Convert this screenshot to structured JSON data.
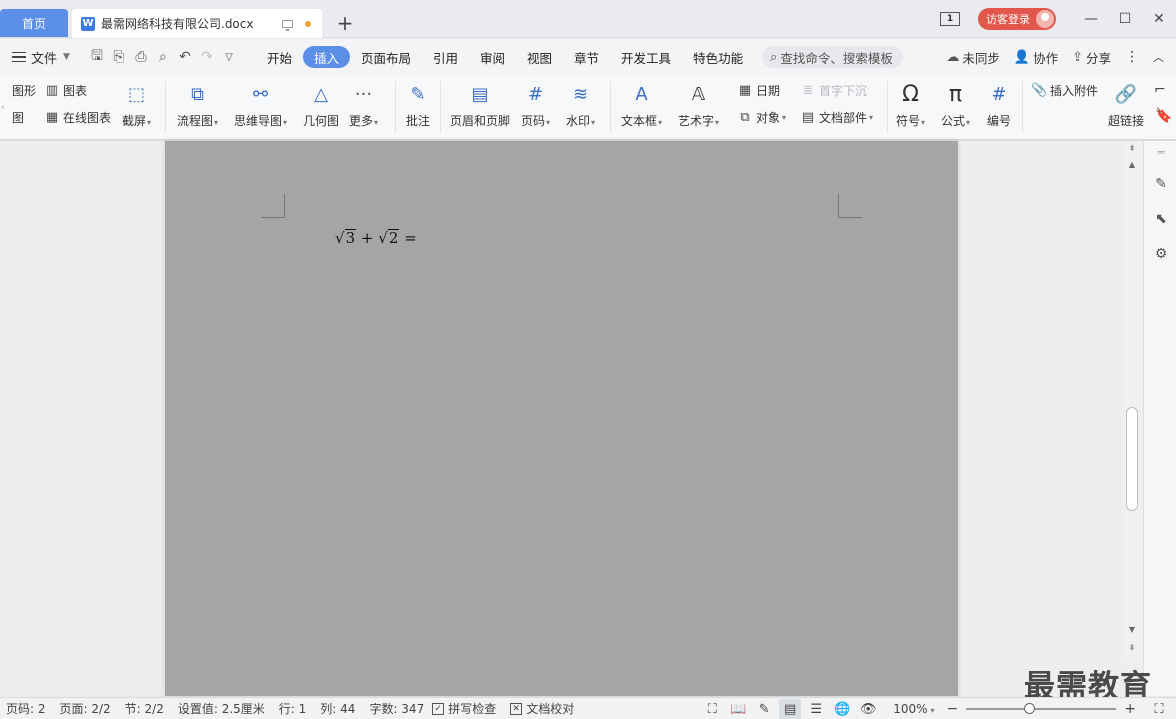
{
  "titlebar": {
    "home_tab": "首页",
    "doc_tab_title": "最需网络科技有限公司.docx",
    "page_indicator": "1",
    "login_label": "访客登录"
  },
  "menu": {
    "file": "文件",
    "tabs": [
      "开始",
      "插入",
      "页面布局",
      "引用",
      "审阅",
      "视图",
      "章节",
      "开发工具",
      "特色功能"
    ],
    "active_tab": "插入",
    "search": "查找命令、搜索模板",
    "sync": "未同步",
    "collab": "协作",
    "share": "分享"
  },
  "ribbon": {
    "shape": "图形",
    "pic": "图",
    "chart": "图表",
    "online_chart": "在线图表",
    "screenshot": "截屏",
    "flowchart": "流程图",
    "mindmap": "思维导图",
    "geometry": "几何图",
    "more": "更多",
    "comment": "批注",
    "header_footer": "页眉和页脚",
    "page_num": "页码",
    "watermark": "水印",
    "textbox": "文本框",
    "wordart": "艺术字",
    "date": "日期",
    "object": "对象",
    "drop_cap": "首字下沉",
    "doc_parts": "文档部件",
    "symbol": "符号",
    "formula": "公式",
    "numbering": "编号",
    "attachment": "插入附件",
    "hyperlink": "超链接"
  },
  "document": {
    "formula_parts": [
      "√",
      "3",
      "+",
      "√",
      "2",
      "="
    ]
  },
  "status": {
    "page_code": "页码: 2",
    "pages": "页面: 2/2",
    "section": "节: 2/2",
    "setting": "设置值: 2.5厘米",
    "row": "行: 1",
    "col": "列: 44",
    "words": "字数: 347",
    "spell": "拼写检查",
    "proof": "文档校对",
    "zoom": "100%"
  },
  "watermark": "最需教育",
  "colors": {
    "accent": "#5b8fe8",
    "login": "#e2574c",
    "page_bg": "#a5a5a5"
  }
}
